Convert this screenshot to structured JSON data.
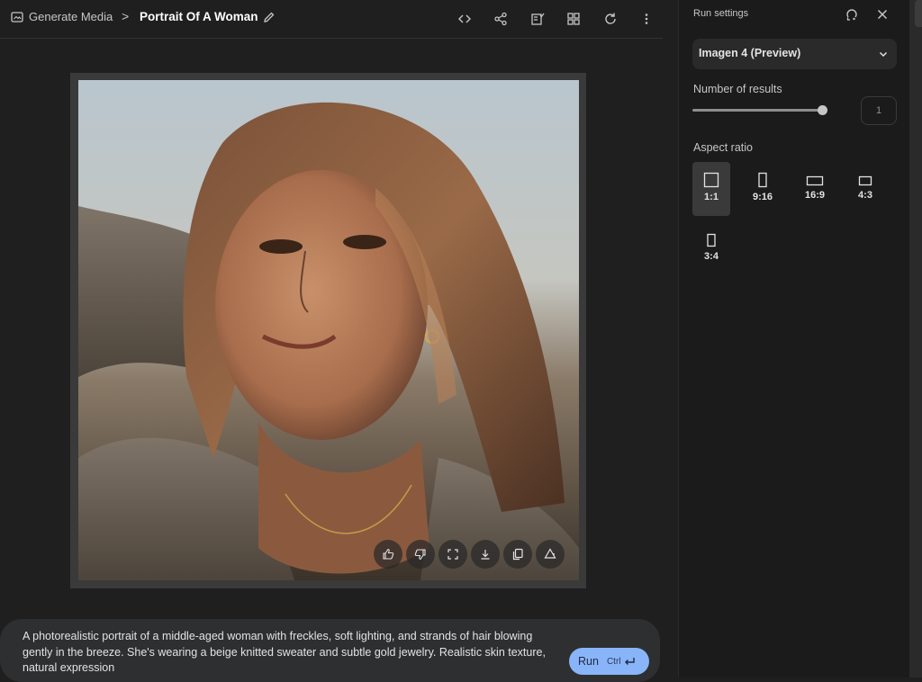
{
  "breadcrumb": {
    "root_label": "Generate Media",
    "separator": ">",
    "icon": "media-icon"
  },
  "page": {
    "title": "Portrait Of A Woman"
  },
  "toolbar": {
    "icons": [
      "code-icon",
      "share-icon",
      "compare-icon",
      "gallery-icon",
      "refresh-icon",
      "more-vert-icon"
    ]
  },
  "image": {
    "description_icons": [
      "thumb-up-icon",
      "thumb-down-icon",
      "fullscreen-icon",
      "download-icon",
      "copy-icon",
      "upload-drive-icon"
    ]
  },
  "prompt": {
    "text": "A photorealistic portrait of a middle-aged woman with freckles, soft lighting, and strands of hair blowing gently in the breeze. She's wearing a beige knitted sweater and subtle gold jewelry. Realistic skin texture, natural expression",
    "run_label": "Run",
    "shortcut": "Ctrl"
  },
  "run_settings": {
    "title": "Run settings",
    "model": "Imagen 4 (Preview)",
    "number_of_results_label": "Number of results",
    "number_of_results_value": "1",
    "aspect_ratio_label": "Aspect ratio",
    "ratios": [
      {
        "label": "1:1",
        "selected": true
      },
      {
        "label": "9:16",
        "selected": false
      },
      {
        "label": "16:9",
        "selected": false
      },
      {
        "label": "4:3",
        "selected": false
      },
      {
        "label": "3:4",
        "selected": false
      }
    ]
  },
  "colors": {
    "accent": "#8ab4f8",
    "background": "#1f1f1f",
    "panel": "#1b1b1b"
  }
}
